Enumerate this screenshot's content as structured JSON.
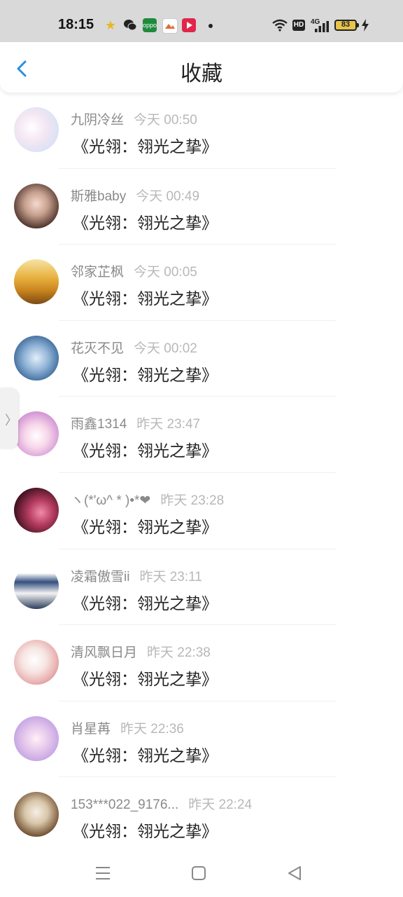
{
  "status_bar": {
    "time": "18:15",
    "hd_label": "HD",
    "network_label": "4G",
    "battery_level": "83",
    "notification_icons": [
      "star-app-icon",
      "wechat-icon",
      "oppo-app-icon",
      "gallery-app-icon",
      "video-app-icon"
    ],
    "system_icons": [
      "wifi-icon",
      "signal-icon",
      "charging-icon"
    ]
  },
  "header": {
    "title": "收藏",
    "back_icon": "chevron-left-icon"
  },
  "colors": {
    "accent": "#2a8de0",
    "status_bar_bg": "#d9d9d9",
    "name_text": "#8a8a8a",
    "time_text": "#b8b8b8",
    "title_text": "#222222"
  },
  "list": {
    "items": [
      {
        "name": "九阴冷丝",
        "time": "今天 00:50",
        "title": "《光翎：翎光之挚》"
      },
      {
        "name": "斯雅baby",
        "time": "今天 00:49",
        "title": "《光翎：翎光之挚》"
      },
      {
        "name": "邻家芷枫",
        "time": "今天 00:05",
        "title": "《光翎：翎光之挚》"
      },
      {
        "name": "花灭不见",
        "time": "今天 00:02",
        "title": "《光翎：翎光之挚》"
      },
      {
        "name": "雨鑫1314",
        "time": "昨天 23:47",
        "title": "《光翎：翎光之挚》"
      },
      {
        "name": "ヽ(*'ω^ * )•*❤",
        "time": "昨天 23:28",
        "title": "《光翎：翎光之挚》"
      },
      {
        "name": "凌霜傲雪ii",
        "time": "昨天 23:11",
        "title": "《光翎：翎光之挚》"
      },
      {
        "name": "清风飘日月",
        "time": "昨天 22:38",
        "title": "《光翎：翎光之挚》"
      },
      {
        "name": "肖星苒",
        "time": "昨天 22:36",
        "title": "《光翎：翎光之挚》"
      },
      {
        "name": "153***022_9176...",
        "time": "昨天 22:24",
        "title": "《光翎：翎光之挚》"
      }
    ]
  },
  "side_handle": {
    "glyph": "〉"
  },
  "nav_bar": {
    "icons": [
      "menu-icon",
      "home-icon",
      "back-icon"
    ]
  }
}
